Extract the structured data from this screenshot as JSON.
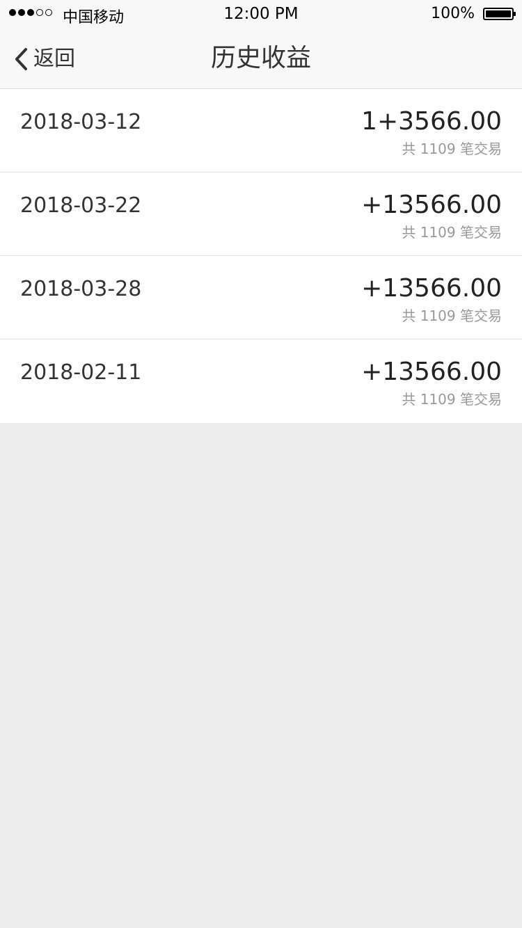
{
  "status_bar": {
    "carrier": "中国移动",
    "time": "12:00 PM",
    "battery": "100%"
  },
  "nav": {
    "back_label": "返回",
    "title": "历史收益"
  },
  "records": [
    {
      "date": "2018-03-12",
      "amount": "1+3566.00",
      "summary": "共 1109 笔交易"
    },
    {
      "date": "2018-03-22",
      "amount": "+13566.00",
      "summary": "共 1109 笔交易"
    },
    {
      "date": "2018-03-28",
      "amount": "+13566.00",
      "summary": "共 1109 笔交易"
    },
    {
      "date": "2018-02-11",
      "amount": "+13566.00",
      "summary": "共 1109 笔交易"
    }
  ],
  "colors": {
    "page_background": "#ededed",
    "bar_background": "#f8f8f8",
    "text_primary": "#333333",
    "text_secondary": "#999999"
  }
}
